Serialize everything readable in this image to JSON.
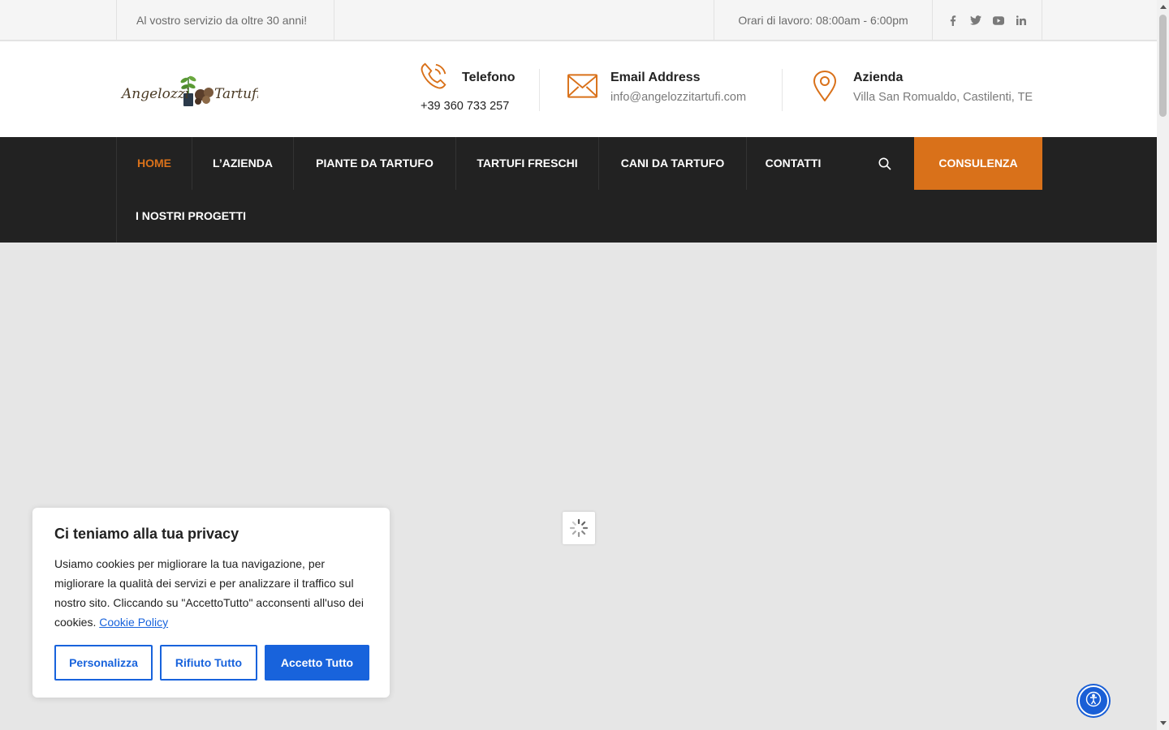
{
  "topbar": {
    "tagline": "Al vostro servizio da oltre 30 anni!",
    "hours": "Orari di lavoro: 08:00am - 6:00pm",
    "social": [
      "facebook-icon",
      "twitter-icon",
      "youtube-icon",
      "linkedin-icon"
    ]
  },
  "header": {
    "logo_text": "Angelozzi Tartufi",
    "phone": {
      "title": "Telefono",
      "value": "+39 360 733 257"
    },
    "email": {
      "title": "Email Address",
      "value": "info@angelozzitartufi.com"
    },
    "company": {
      "title": "Azienda",
      "value": "Villa San Romualdo, Castilenti, TE"
    }
  },
  "nav": {
    "items": [
      "HOME",
      "L’AZIENDA",
      "PIANTE DA TARTUFO",
      "TARTUFI FRESCHI",
      "CANI DA TARTUFO",
      "CONTATTI",
      "I NOSTRI PROGETTI"
    ],
    "cta": "CONSULENZA"
  },
  "cookie": {
    "title": "Ci teniamo alla tua privacy",
    "text": "Usiamo cookies per migliorare la tua navigazione, per migliorare la qualità dei servizi e per analizzare il traffico sul nostro sito. Cliccando su \"AccettoTutto\" acconsenti all'uso dei cookies.",
    "link": "Cookie Policy",
    "customize": "Personalizza",
    "reject": "Rifiuto Tutto",
    "accept": "Accetto Tutto"
  },
  "colors": {
    "accent": "#d9711a",
    "nav_bg": "#222222",
    "cookie_blue": "#1863dc"
  }
}
